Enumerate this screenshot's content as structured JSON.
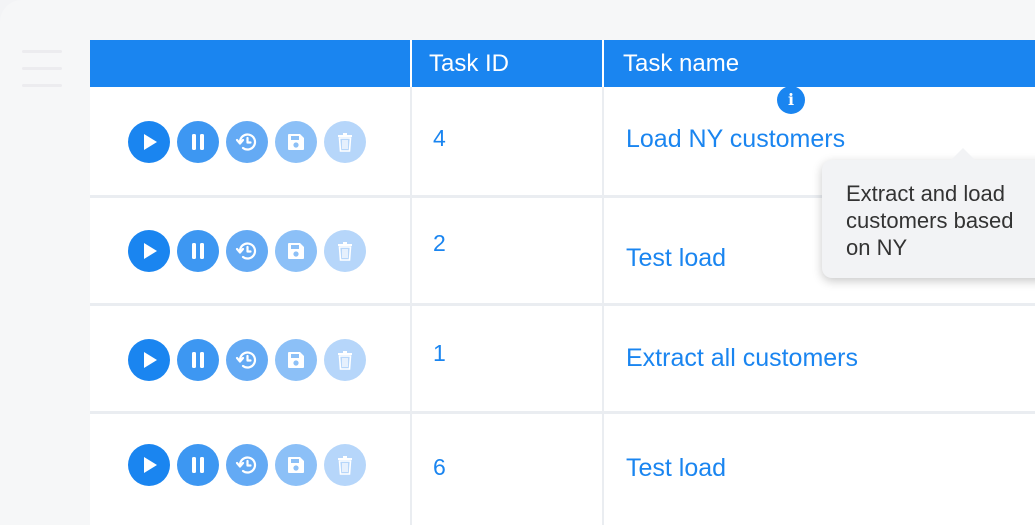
{
  "table": {
    "headers": {
      "actions": "",
      "task_id": "Task ID",
      "task_name": "Task name"
    },
    "rows": [
      {
        "task_id": "4",
        "task_name": "Load NY customers",
        "has_info": true
      },
      {
        "task_id": "2",
        "task_name": "Test load"
      },
      {
        "task_id": "1",
        "task_name": "Extract all customers"
      },
      {
        "task_id": "6",
        "task_name": "Test load"
      }
    ],
    "actions": [
      "play-icon",
      "pause-icon",
      "history-icon",
      "save-icon",
      "trash-icon"
    ]
  },
  "tooltip": {
    "text": "Extract and load customers based on NY"
  },
  "colors": {
    "header_bg": "#1a85f0",
    "link_text": "#1a85f0",
    "play": "#1a85f0",
    "pause": "#3d97f2",
    "history": "#64aaf4",
    "save": "#8cc0f7",
    "delete": "#b6d6fa"
  }
}
